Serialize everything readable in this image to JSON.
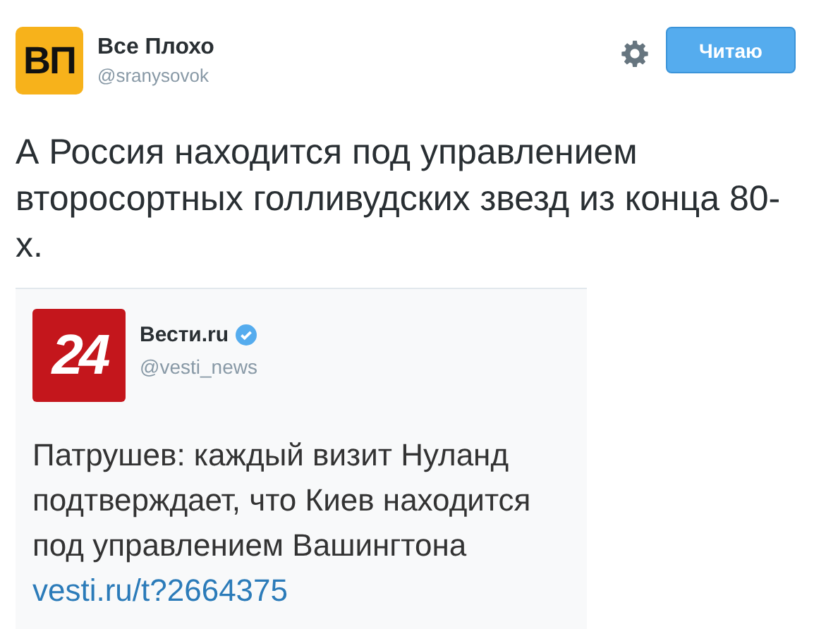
{
  "author": {
    "avatar_text": "ВП",
    "name": "Все Плохо",
    "handle": "@sranysovok"
  },
  "follow_button": "Читаю",
  "text": "А Россия находится под управлением второсортных голливудских звезд из конца 80-х.",
  "quoted": {
    "logo_text": "24",
    "name": "Вести.ru",
    "handle": "@vesti_news",
    "text": "Патрушев: каждый визит Нуланд подтверждает, что Киев находится под управлением Вашингтона",
    "link": "vesti.ru/t?2664375"
  }
}
